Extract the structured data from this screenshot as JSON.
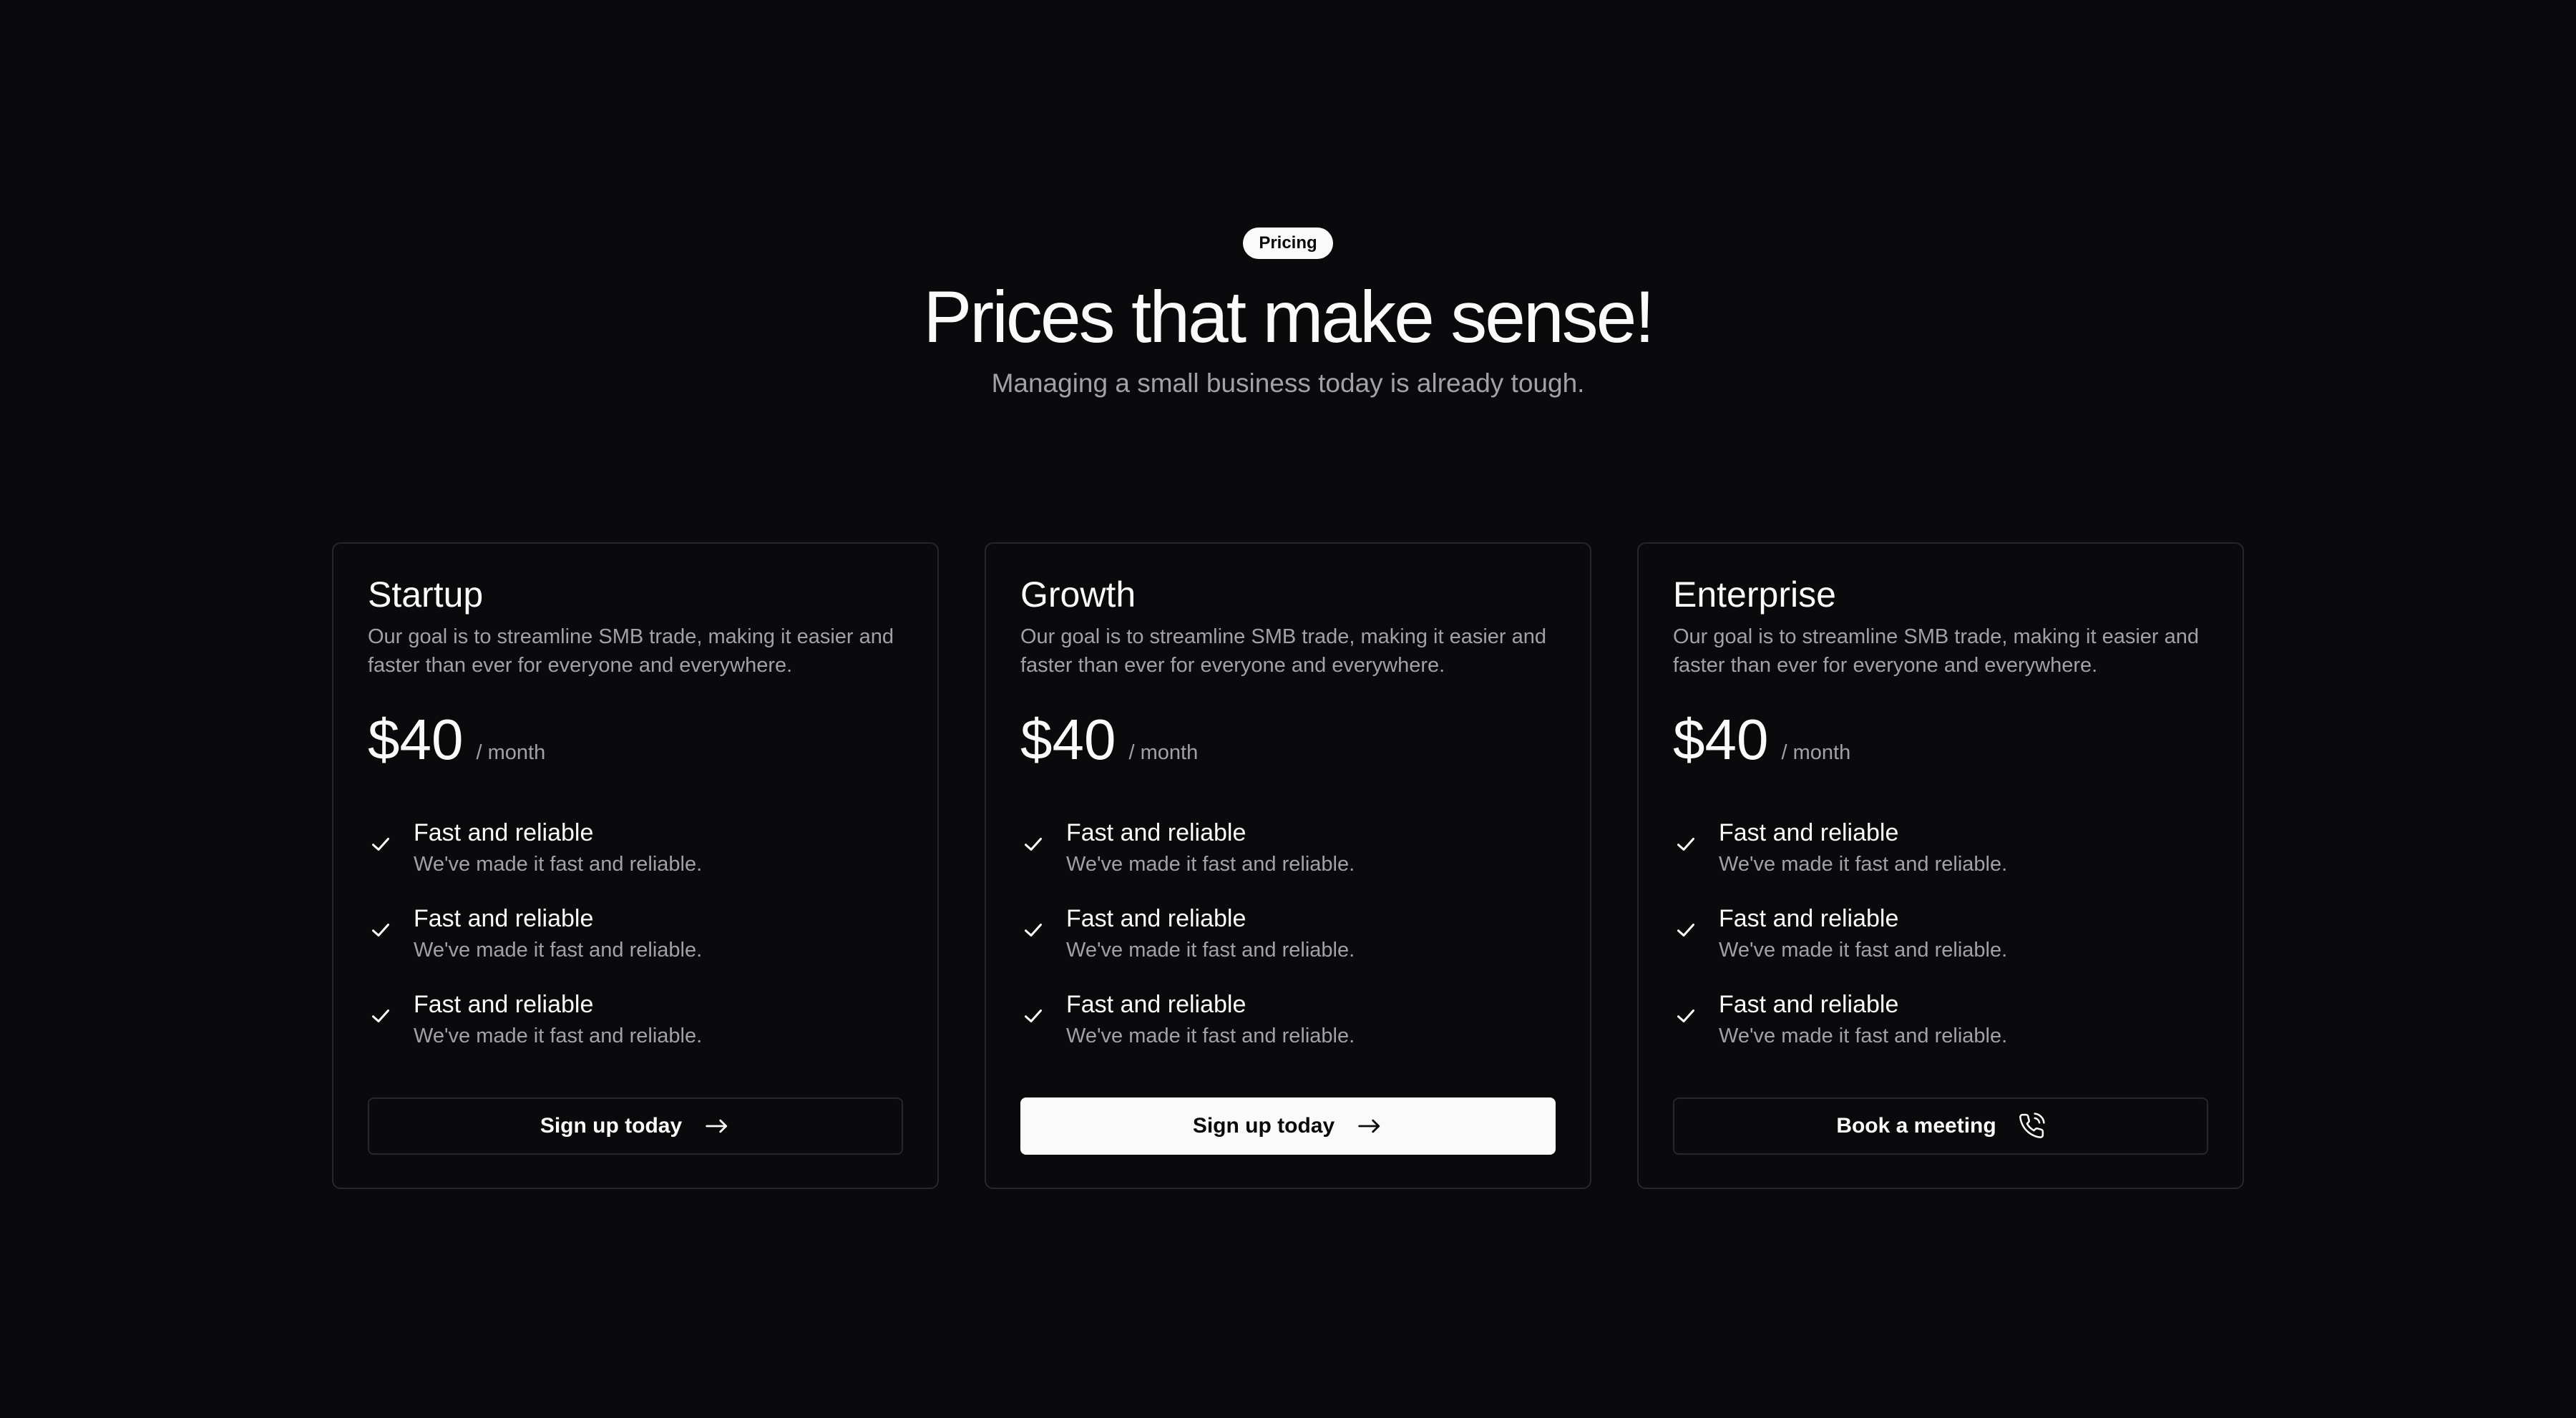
{
  "header": {
    "badge": "Pricing",
    "title": "Prices that make sense!",
    "subtitle": "Managing a small business today is already tough."
  },
  "plans": [
    {
      "name": "Startup",
      "description": "Our goal is to streamline SMB trade, making it easier and faster than ever for everyone and everywhere.",
      "price": "$40",
      "period": "/ month",
      "features": [
        {
          "title": "Fast and reliable",
          "subtitle": "We've made it fast and reliable."
        },
        {
          "title": "Fast and reliable",
          "subtitle": "We've made it fast and reliable."
        },
        {
          "title": "Fast and reliable",
          "subtitle": "We've made it fast and reliable."
        }
      ],
      "cta": {
        "label": "Sign up today",
        "icon": "arrow-right-icon",
        "style": "outline"
      }
    },
    {
      "name": "Growth",
      "description": "Our goal is to streamline SMB trade, making it easier and faster than ever for everyone and everywhere.",
      "price": "$40",
      "period": "/ month",
      "features": [
        {
          "title": "Fast and reliable",
          "subtitle": "We've made it fast and reliable."
        },
        {
          "title": "Fast and reliable",
          "subtitle": "We've made it fast and reliable."
        },
        {
          "title": "Fast and reliable",
          "subtitle": "We've made it fast and reliable."
        }
      ],
      "cta": {
        "label": "Sign up today",
        "icon": "arrow-right-icon",
        "style": "primary"
      }
    },
    {
      "name": "Enterprise",
      "description": "Our goal is to streamline SMB trade, making it easier and faster than ever for everyone and everywhere.",
      "price": "$40",
      "period": "/ month",
      "features": [
        {
          "title": "Fast and reliable",
          "subtitle": "We've made it fast and reliable."
        },
        {
          "title": "Fast and reliable",
          "subtitle": "We've made it fast and reliable."
        },
        {
          "title": "Fast and reliable",
          "subtitle": "We've made it fast and reliable."
        }
      ],
      "cta": {
        "label": "Book a meeting",
        "icon": "phone-call-icon",
        "style": "outline"
      }
    }
  ],
  "colors": {
    "background": "#0a0a0c",
    "card_border": "#27272a",
    "text_primary": "#fafafa",
    "text_muted": "#a1a1aa",
    "primary_button_bg": "#fafafa",
    "primary_button_text": "#0a0a0c"
  }
}
